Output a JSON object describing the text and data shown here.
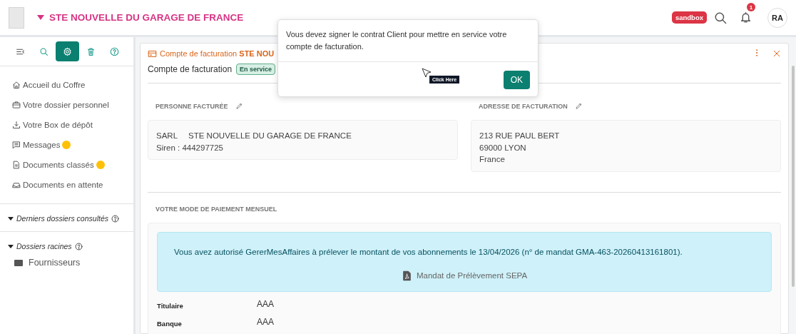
{
  "header": {
    "company": "STE NOUVELLE DU GARAGE DE FRANCE",
    "env_badge": "sandbox",
    "notification_count": "1",
    "avatar": "RA"
  },
  "toolbar": [
    {
      "kind": "collapse",
      "selected": false
    },
    {
      "kind": "search",
      "selected": false
    },
    {
      "kind": "settings",
      "selected": true
    },
    {
      "kind": "trash",
      "selected": false
    },
    {
      "kind": "help",
      "selected": false
    }
  ],
  "nav": [
    {
      "kind": "home",
      "label": "Accueil du Coffre",
      "unread": false
    },
    {
      "kind": "briefcase",
      "label": "Votre dossier personnel",
      "unread": false
    },
    {
      "kind": "download",
      "label": "Votre Box de dépôt",
      "unread": false
    },
    {
      "kind": "message",
      "label": "Messages",
      "unread": true
    },
    {
      "kind": "document",
      "label": "Documents classés",
      "unread": true
    },
    {
      "kind": "inbox",
      "label": "Documents en attente",
      "unread": false
    }
  ],
  "sections": [
    {
      "title": "Derniers dossiers consultés",
      "expanded": true
    },
    {
      "title": "Dossiers racines",
      "expanded": true,
      "children": [
        {
          "label": "Fournisseurs"
        }
      ]
    }
  ],
  "panel": {
    "title": "Compte de facturation **STE NOU**",
    "subtitle": "Compte de facturation",
    "status": "En service",
    "billed_person": {
      "heading": "PERSONNE FACTURÉE",
      "legal_form": "SARL",
      "name": "STE NOUVELLE DU GARAGE DE FRANCE",
      "siren": "Siren : 444297725"
    },
    "billing_address": {
      "heading": "ADRESSE DE FACTURATION",
      "lines": [
        "213 RUE PAUL BERT",
        "69000 LYON",
        "France"
      ]
    },
    "payment": {
      "heading": "VOTRE MODE DE PAIEMENT MENSUEL",
      "notice": "Vous avez autorisé GererMesAffaires à prélever le montant de vos abonnements le 13/04/2026 (n° de mandat GMA-463-20260413161801).",
      "mandate_link": "Mandat de Prélèvement SEPA",
      "fields": [
        {
          "label": "Titulaire",
          "value": "AAA"
        },
        {
          "label": "Banque",
          "value": "AAA"
        }
      ]
    }
  },
  "dialog": {
    "message": "Vous devez signer le contrat Client pour mettre en service votre compte de facturation.",
    "tooltip": "Click Here",
    "ok_button": "OK"
  }
}
